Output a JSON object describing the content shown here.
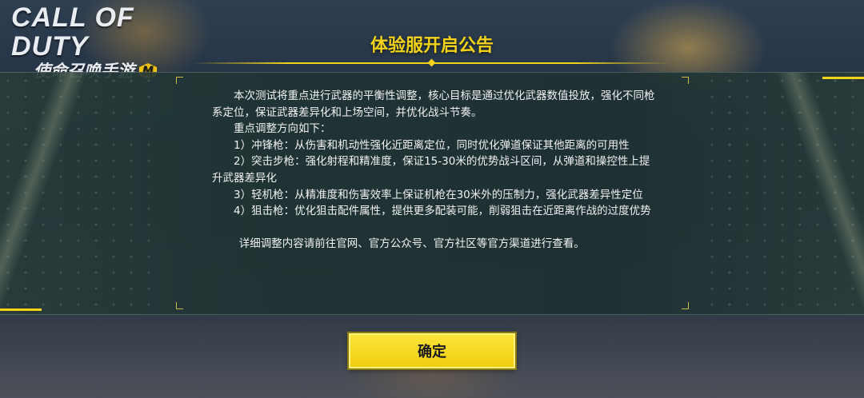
{
  "logo": {
    "line1": "CALL OF DUTY",
    "line2": "使命召唤手游",
    "badge": "M"
  },
  "dialog": {
    "title": "体验服开启公告",
    "paragraph1": "本次测试将重点进行武器的平衡性调整，核心目标是通过优化武器数值投放，强化不同枪系定位，保证武器差异化和上场空间，并优化战斗节奏。",
    "heading": "重点调整方向如下：",
    "items": [
      "1）冲锋枪：从伤害和机动性强化近距离定位，同时优化弹道保证其他距离的可用性",
      "2）突击步枪：强化射程和精准度，保证15-30米的优势战斗区间，从弹道和操控性上提升武器差异化",
      "3）轻机枪：从精准度和伤害效率上保证机枪在30米外的压制力，强化武器差异性定位",
      "4）狙击枪：优化狙击配件属性，提供更多配装可能，削弱狙击在近距离作战的过度优势"
    ],
    "footer": "详细调整内容请前往官网、官方公众号、官方社区等官方渠道进行查看。",
    "confirm_label": "确定"
  },
  "colors": {
    "accent": "#f3d31a",
    "panel": "#203434",
    "text": "#f2f2f2"
  }
}
